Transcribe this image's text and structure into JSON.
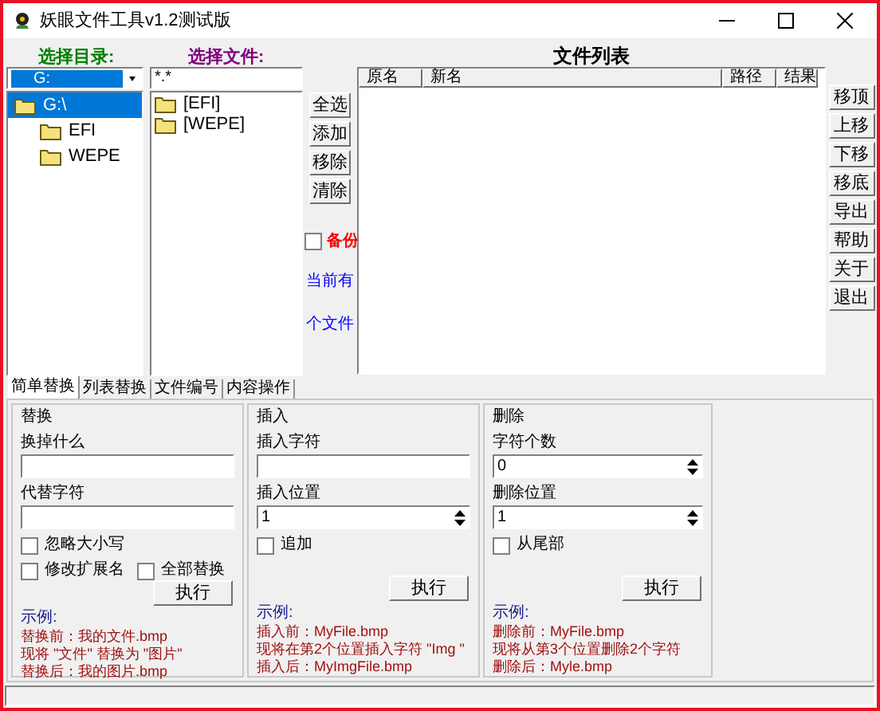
{
  "window": {
    "title": "妖眼文件工具v1.2测试版"
  },
  "directory": {
    "label": "选择目录:",
    "drive": "G:",
    "tree": [
      {
        "label": "G:\\",
        "selected": true,
        "children": [
          {
            "label": "EFI",
            "selected": false
          },
          {
            "label": "WEPE",
            "selected": false
          }
        ]
      }
    ]
  },
  "files": {
    "label": "选择文件:",
    "filter": "*.*",
    "items": [
      "[EFI]",
      "[WEPE]"
    ]
  },
  "list_buttons": [
    "全选",
    "添加",
    "移除",
    "清除"
  ],
  "backup": {
    "label": "备份",
    "checked": false
  },
  "current_label": "当前有",
  "count_label": "个文件",
  "file_list": {
    "title": "文件列表",
    "columns": [
      "原名",
      "新名",
      "路径",
      "结果"
    ]
  },
  "side_buttons": [
    "移顶",
    "上移",
    "下移",
    "移底",
    "导出",
    "帮助",
    "关于",
    "退出"
  ],
  "tabs": [
    {
      "label": "简单替换",
      "selected": true
    },
    {
      "label": "列表替换",
      "selected": false
    },
    {
      "label": "文件编号",
      "selected": false
    },
    {
      "label": "内容操作",
      "selected": false
    }
  ],
  "groups": [
    {
      "title": "替换",
      "fields": [
        {
          "kind": "text",
          "label": "换掉什么"
        },
        {
          "kind": "text",
          "label": "代替字符"
        }
      ],
      "checkboxes": [
        {
          "label": "忽略大小写",
          "checked": false
        },
        {
          "label": "修改扩展名",
          "checked": false
        },
        {
          "label": "全部替换",
          "checked": false
        }
      ],
      "button": "执行",
      "example_title": "示例:",
      "example_lines": [
        "替换前：我的文件.bmp",
        "现将 \"文件\" 替换为 \"图片\"",
        "替换后：我的图片.bmp"
      ]
    },
    {
      "title": "插入",
      "fields": [
        {
          "kind": "text",
          "label": "插入字符"
        },
        {
          "kind": "spin",
          "label": "插入位置",
          "value": "1"
        }
      ],
      "checkboxes": [
        {
          "label": "追加",
          "checked": false
        }
      ],
      "button": "执行",
      "example_title": "示例:",
      "example_lines": [
        "插入前：MyFile.bmp",
        "现将在第2个位置插入字符 \"Img \"",
        "插入后：MyImgFile.bmp"
      ]
    },
    {
      "title": "删除",
      "fields": [
        {
          "kind": "spin",
          "label": "字符个数",
          "value": "0"
        },
        {
          "kind": "spin",
          "label": "删除位置",
          "value": "1"
        }
      ],
      "checkboxes": [
        {
          "label": "从尾部",
          "checked": false
        }
      ],
      "button": "执行",
      "example_title": "示例:",
      "example_lines": [
        "删除前：MyFile.bmp",
        "现将从第3个位置删除2个字符",
        "删除后：Myle.bmp"
      ]
    }
  ]
}
